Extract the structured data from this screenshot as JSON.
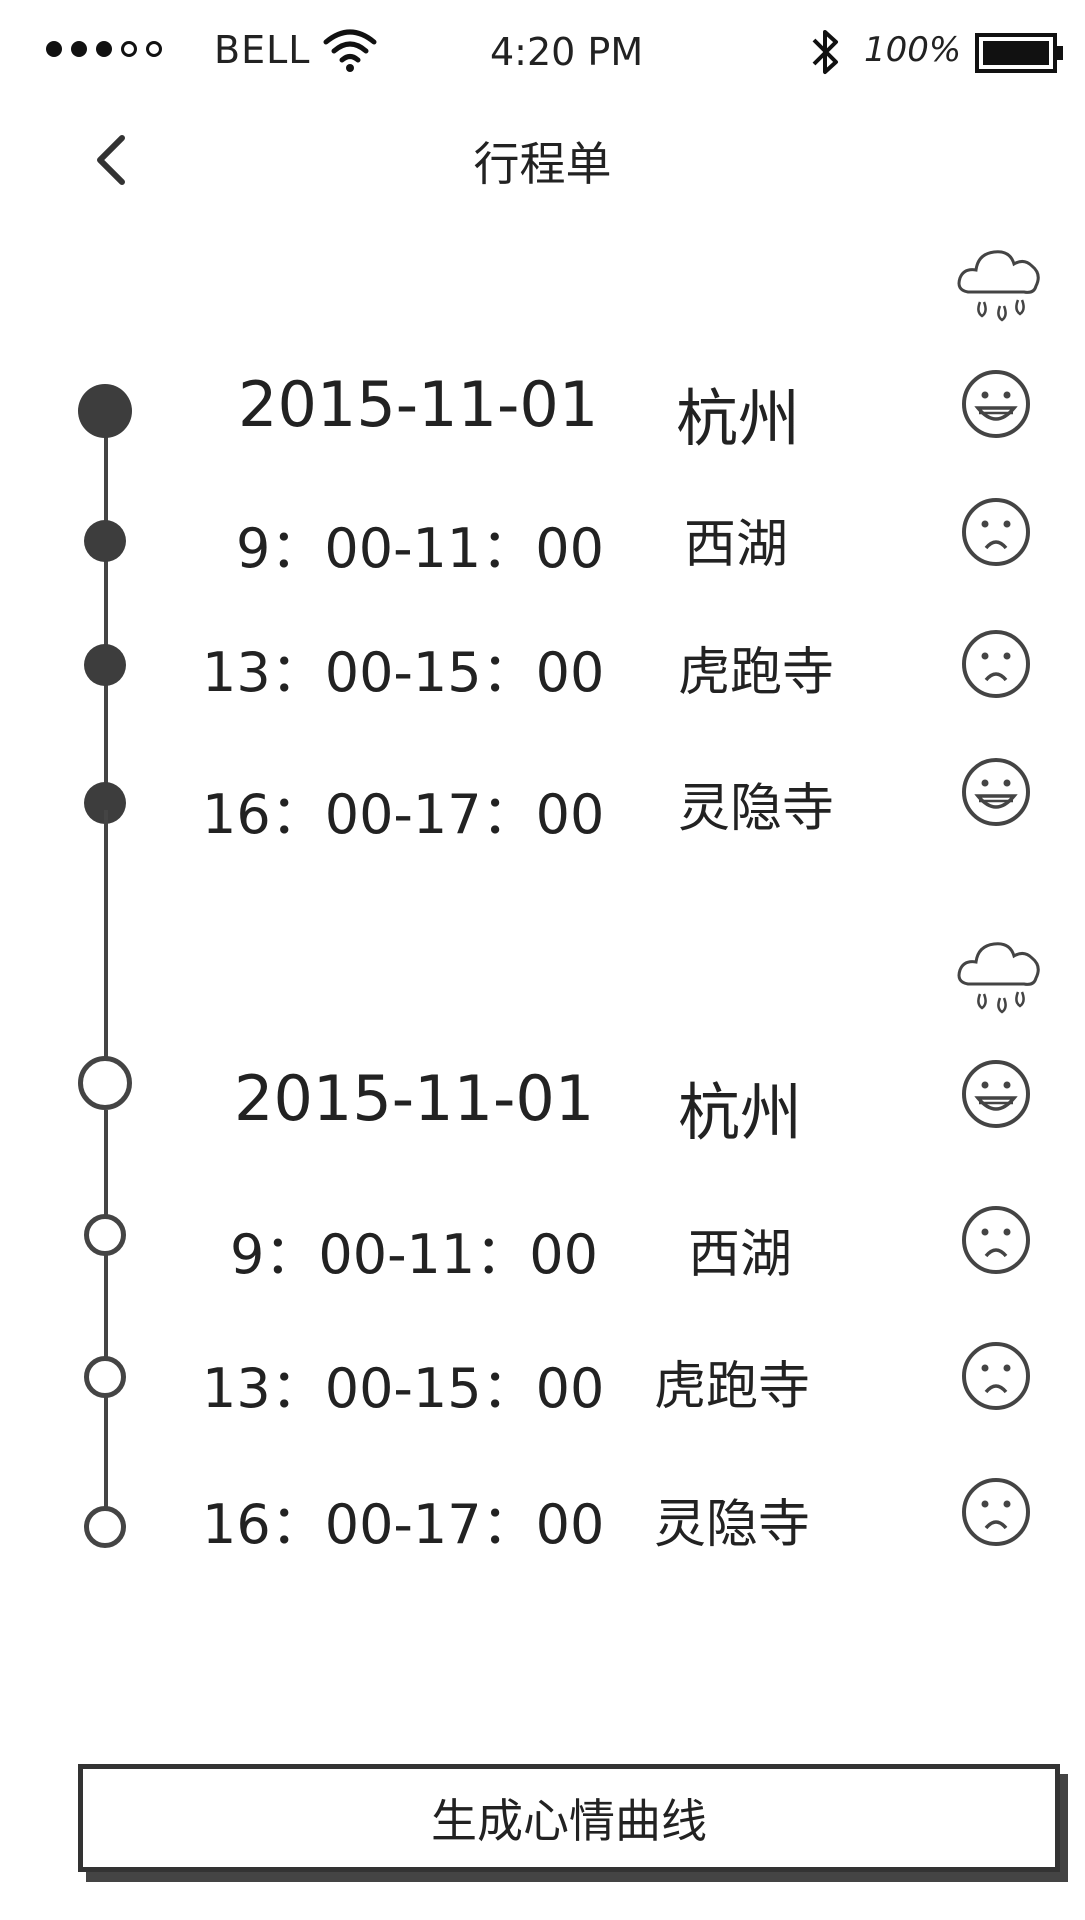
{
  "status_bar": {
    "carrier": "BELL",
    "time": "4:20 PM",
    "battery_percent": "100%",
    "signal": {
      "filled": 3,
      "empty": 2
    }
  },
  "nav": {
    "title": "行程单",
    "back_icon": "chevron-left-icon"
  },
  "itinerary": [
    {
      "date": "2015-11-01",
      "city": "杭州",
      "marker": "filled",
      "weather_icon": "rain-cloud-icon",
      "mood_icon": "happy-face-icon",
      "items": [
        {
          "time": "9：00-11：00",
          "place": "西湖",
          "mood_icon": "sad-face-icon"
        },
        {
          "time": "13：00-15：00",
          "place": "虎跑寺",
          "mood_icon": "sad-face-icon"
        },
        {
          "time": "16：00-17：00",
          "place": "灵隐寺",
          "mood_icon": "happy-face-icon"
        }
      ]
    },
    {
      "date": "2015-11-01",
      "city": "杭州",
      "marker": "hollow",
      "weather_icon": "rain-cloud-icon",
      "mood_icon": "happy-face-icon",
      "items": [
        {
          "time": "9：00-11：00",
          "place": "西湖",
          "mood_icon": "sad-face-icon"
        },
        {
          "time": "13：00-15：00",
          "place": "虎跑寺",
          "mood_icon": "sad-face-icon"
        },
        {
          "time": "16：00-17：00",
          "place": "灵隐寺",
          "mood_icon": "sad-face-icon"
        }
      ]
    }
  ],
  "actions": {
    "generate_label": "生成心情曲线"
  },
  "colors": {
    "ink": "#222222",
    "line": "#444444",
    "background": "#ffffff"
  }
}
